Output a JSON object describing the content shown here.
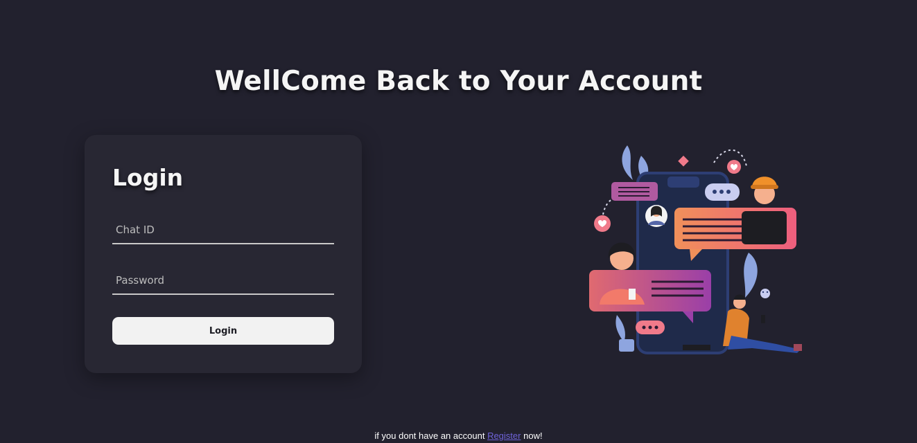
{
  "heading": "WellCome Back to Your Account",
  "login_card": {
    "title": "Login",
    "chat_id_placeholder": "Chat ID",
    "password_placeholder": "Password",
    "button_label": "Login"
  },
  "footer": {
    "prefix": "if you dont have an account",
    "link_label": "Register",
    "suffix": "now!"
  },
  "colors": {
    "background": "#22212e",
    "card": "#282733",
    "button": "#f2f2f2",
    "link": "#6f63d9"
  },
  "icons": [
    "chat-illustration"
  ]
}
